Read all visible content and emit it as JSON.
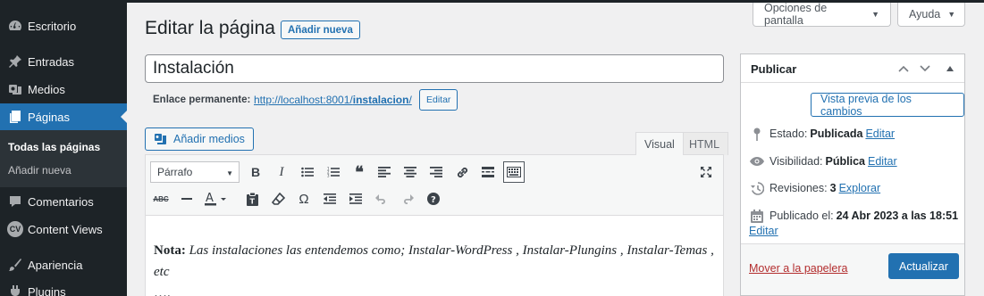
{
  "sidebar": {
    "items": [
      {
        "label": "Escritorio",
        "icon": "dashboard-icon"
      },
      {
        "label": "Entradas",
        "icon": "pin-icon"
      },
      {
        "label": "Medios",
        "icon": "media-icon"
      },
      {
        "label": "Páginas",
        "icon": "pages-icon"
      },
      {
        "label": "Comentarios",
        "icon": "comment-icon"
      },
      {
        "label": "Content Views",
        "icon": "cv-icon",
        "badge": "CV"
      },
      {
        "label": "Apariencia",
        "icon": "appearance-icon"
      },
      {
        "label": "Plugins",
        "icon": "plugins-icon"
      }
    ],
    "submenu": {
      "all_pages": "Todas las páginas",
      "add_new": "Añadir nueva"
    }
  },
  "screen_meta": {
    "options_label": "Opciones de pantalla",
    "help_label": "Ayuda"
  },
  "header": {
    "title": "Editar la página",
    "add_new_label": "Añadir nueva"
  },
  "post": {
    "title": "Instalación"
  },
  "permalink": {
    "label": "Enlace permanente:",
    "url_base": "http://localhost:8001/",
    "slug": "instalacion",
    "url_tail": "/",
    "edit_label": "Editar"
  },
  "editor": {
    "add_media_label": "Añadir medios",
    "tab_visual": "Visual",
    "tab_html": "HTML",
    "format_value": "Párrafo",
    "content": {
      "note_label": "Nota:",
      "note_text": "Las instalaciones las entendemos como; Instalar-WordPress , Instalar-Plungins , Instalar-Temas , etc",
      "ellipsis": "…."
    }
  },
  "publish": {
    "title": "Publicar",
    "preview_label": "Vista previa de los cambios",
    "status_label": "Estado:",
    "status_value": "Publicada",
    "status_edit": "Editar",
    "visibility_label": "Visibilidad:",
    "visibility_value": "Pública",
    "visibility_edit": "Editar",
    "revisions_label": "Revisiones:",
    "revisions_value": "3",
    "revisions_link": "Explorar",
    "published_label": "Publicado el:",
    "published_value": "24 Abr 2023 a las 18:51",
    "published_edit": "Editar",
    "trash_label": "Mover a la papelera",
    "update_label": "Actualizar"
  },
  "colors": {
    "accent": "#2271b1",
    "sidebar_bg": "#1d2327",
    "danger": "#b32d2e"
  }
}
